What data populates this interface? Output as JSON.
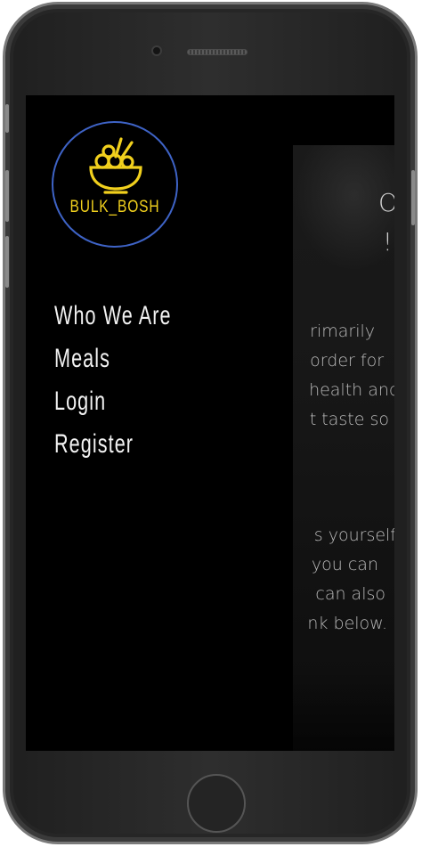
{
  "brand": {
    "logo_text": "BULK_BOSH",
    "accent": "#f1d01d",
    "ring": "#3e63c6"
  },
  "nav": {
    "items": [
      {
        "label": "Who We Are"
      },
      {
        "label": "Meals"
      },
      {
        "label": "Login"
      },
      {
        "label": "Register"
      }
    ]
  },
  "background_content": {
    "heading_lines": [
      "O",
      "!"
    ],
    "paragraph1": [
      "rimarily",
      "order for",
      "health and",
      "t taste so"
    ],
    "paragraph2": [
      "s yourself",
      "you can",
      "can also",
      "nk below."
    ]
  },
  "icons": [
    "bowl-icon",
    "camera-icon",
    "speaker-icon",
    "home-button"
  ]
}
